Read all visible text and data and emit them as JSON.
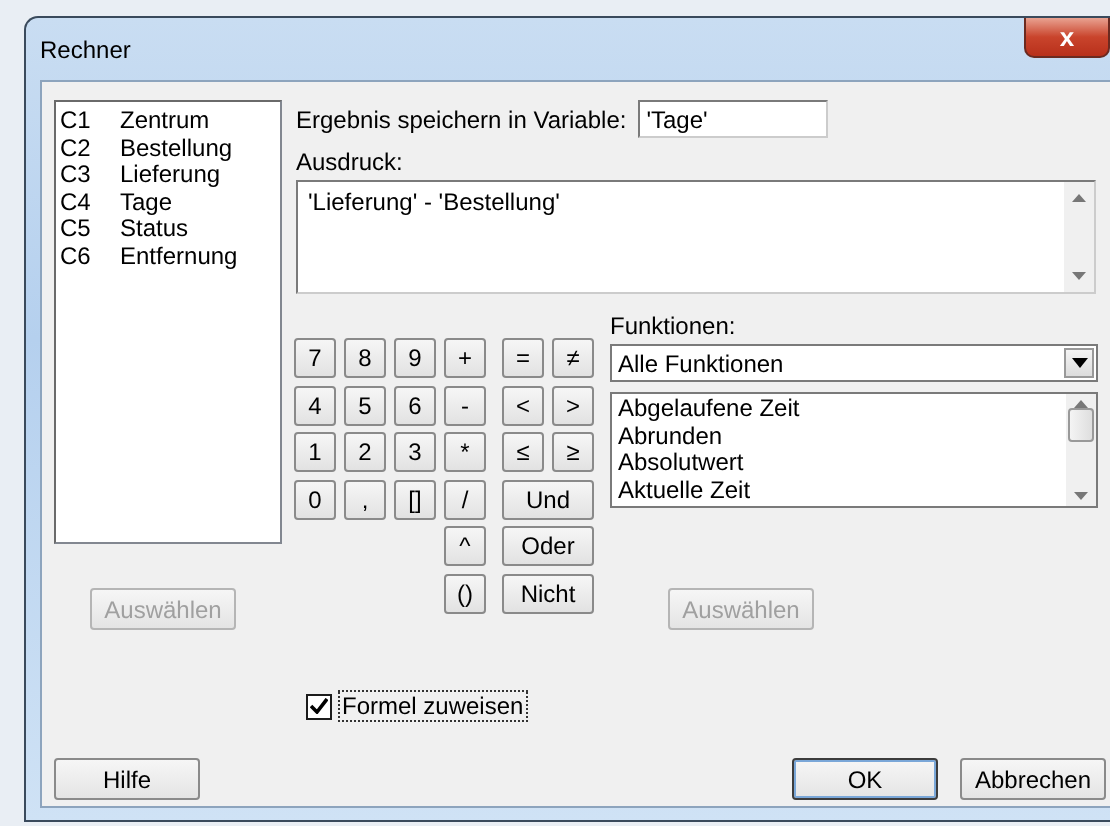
{
  "window": {
    "title": "Rechner",
    "close": "x"
  },
  "columns": [
    {
      "id": "C1",
      "name": "Zentrum"
    },
    {
      "id": "C2",
      "name": "Bestellung"
    },
    {
      "id": "C3",
      "name": "Lieferung"
    },
    {
      "id": "C4",
      "name": "Tage"
    },
    {
      "id": "C5",
      "name": "Status"
    },
    {
      "id": "C6",
      "name": "Entfernung"
    }
  ],
  "columns_select": {
    "label": "Auswählen",
    "disabled": true
  },
  "result": {
    "label": "Ergebnis speichern in Variable:",
    "value": "'Tage'"
  },
  "expression": {
    "label": "Ausdruck:",
    "value": "'Lieferung' - 'Bestellung'"
  },
  "keypad": [
    {
      "digits": [
        "7",
        "8",
        "9"
      ],
      "operator": "+",
      "logic": [
        "=",
        "≠"
      ]
    },
    {
      "digits": [
        "4",
        "5",
        "6"
      ],
      "operator": "-",
      "logic": [
        "<",
        ">"
      ]
    },
    {
      "digits": [
        "1",
        "2",
        "3"
      ],
      "operator": "*",
      "logic": [
        "≤",
        "≥"
      ]
    },
    {
      "digits": [
        "0",
        ",",
        "[]"
      ],
      "operator": "/",
      "logic": [
        "Und"
      ]
    },
    {
      "operator": "^",
      "logic": [
        "Oder"
      ]
    },
    {
      "operator": "()",
      "logic": [
        "Nicht"
      ]
    }
  ],
  "functions": {
    "label": "Funktionen:",
    "category": "Alle Funktionen",
    "items": [
      "Abgelaufene Zeit",
      "Abrunden",
      "Absolutwert",
      "Aktuelle Zeit"
    ],
    "select": {
      "label": "Auswählen",
      "disabled": true
    }
  },
  "assign_formula": {
    "label": "Formel zuweisen",
    "checked": true
  },
  "buttons": [
    {
      "label": "Hilfe",
      "default": false
    },
    {
      "label": "OK",
      "default": true
    },
    {
      "label": "Abbrechen",
      "default": false
    }
  ]
}
